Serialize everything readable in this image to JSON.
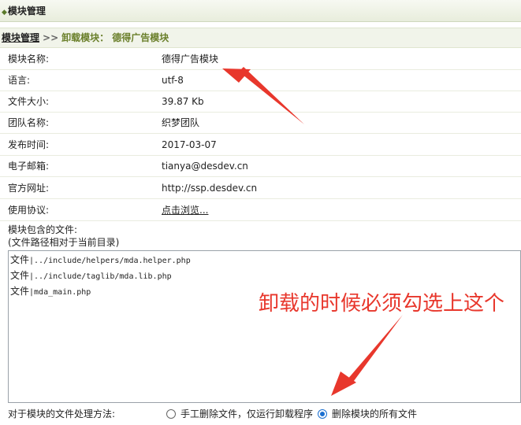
{
  "window": {
    "title": "模块管理",
    "title_icon": "diamond-bullet-icon"
  },
  "breadcrumb": {
    "root": "模块管理",
    "separator": ">>",
    "current": "卸载模块：  德得广告模块"
  },
  "info_rows": [
    {
      "label": "模块名称:",
      "value": "德得广告模块"
    },
    {
      "label": "语言:",
      "value": "utf-8"
    },
    {
      "label": "文件大小:",
      "value": "39.87 Kb"
    },
    {
      "label": "团队名称:",
      "value": "织梦团队"
    },
    {
      "label": "发布时间:",
      "value": "2017-03-07"
    },
    {
      "label": "电子邮箱:",
      "value": "tianya@desdev.cn"
    },
    {
      "label": "官方网址:",
      "value": "http://ssp.desdev.cn"
    },
    {
      "label": "使用协议:",
      "value": "点击浏览..."
    }
  ],
  "files_section": {
    "label": "模块包含的文件:",
    "sublabel": "(文件路径相对于当前目录)",
    "files": [
      {
        "type": "文件",
        "path": "|../include/helpers/mda.helper.php"
      },
      {
        "type": "文件",
        "path": "|../include/taglib/mda.lib.php"
      },
      {
        "type": "文件",
        "path": "|mda_main.php"
      }
    ]
  },
  "file_handling": {
    "label": "对于模块的文件处理方法:",
    "options": [
      {
        "label": "手工删除文件，仅运行卸载程序",
        "selected": false
      },
      {
        "label": "删除模块的所有文件",
        "selected": true
      }
    ]
  },
  "annotation": {
    "text": "卸载的时候必须勾选上这个",
    "color": "#e8372c"
  }
}
